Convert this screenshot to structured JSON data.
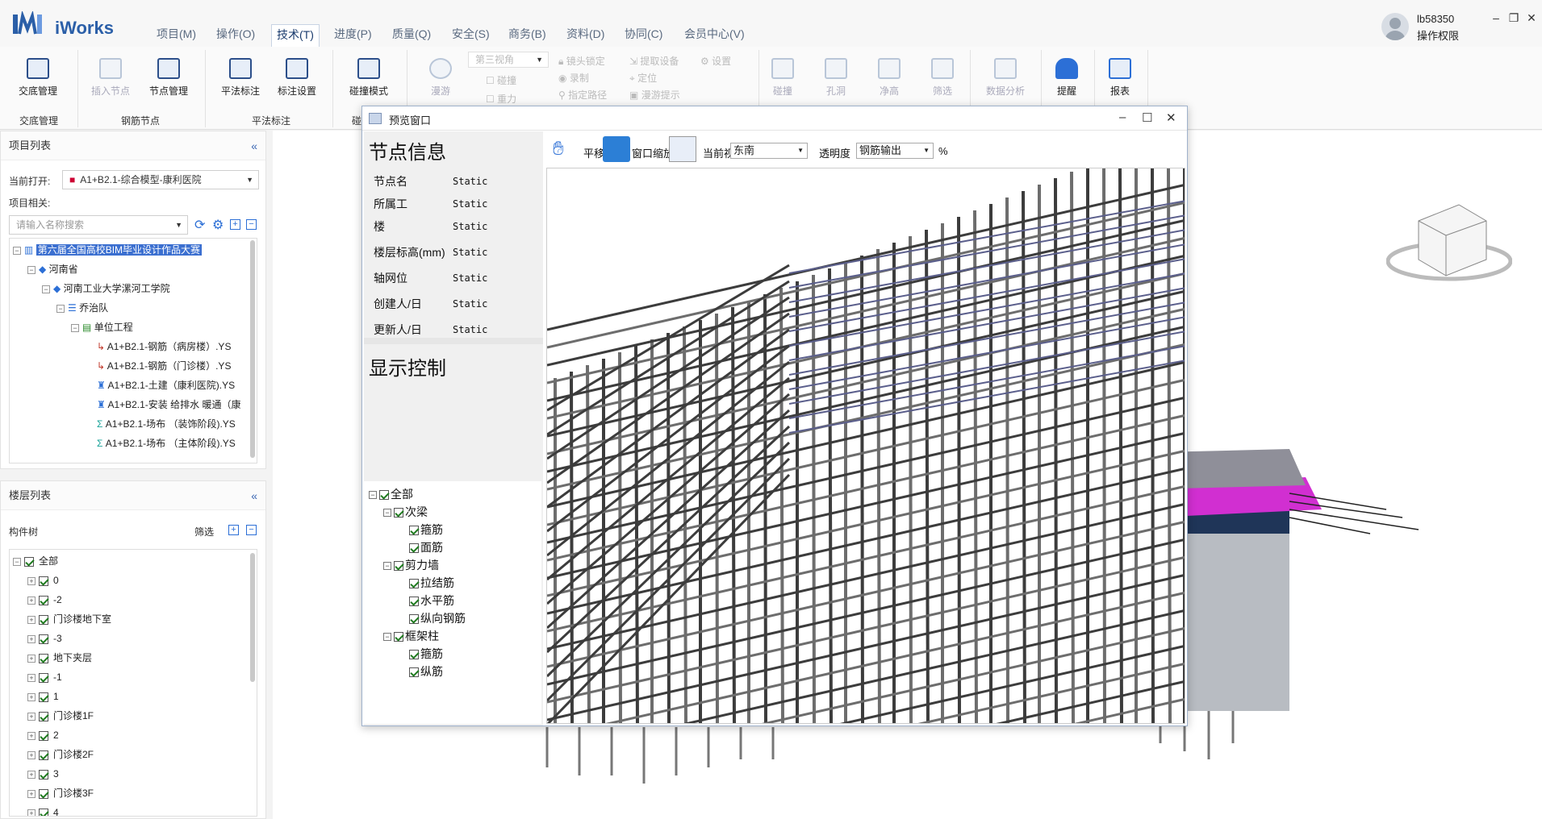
{
  "app": {
    "name": "iWorks"
  },
  "menu": [
    "项目(M)",
    "操作(O)",
    "技术(T)",
    "进度(P)",
    "质量(Q)",
    "安全(S)",
    "商务(B)",
    "资料(D)",
    "协同(C)",
    "会员中心(V)"
  ],
  "menu_active": "技术(T)",
  "user": {
    "name": "lb58350",
    "role": "操作权限"
  },
  "ribbon": {
    "buttons": {
      "jiaodi": "交底管理",
      "insert_node": "插入节点",
      "node_mgmt": "节点管理",
      "pingfa_mark": "平法标注",
      "mark_settings": "标注设置",
      "clash_mode": "碰撞模式",
      "roam": "漫游",
      "clash": "碰撞",
      "hole": "孔洞",
      "net_height": "净高",
      "filter": "筛选",
      "data_analysis": "数据分析",
      "remind": "提醒",
      "report": "报表"
    },
    "options": {
      "view3": "第三视角",
      "lens_lock": "镜头锁定",
      "extract_device": "提取设备",
      "settings": "设置",
      "collide": "碰撞",
      "record": "录制",
      "locate": "定位",
      "gravity": "重力",
      "set_path": "指定路径",
      "roam_hint": "漫游提示"
    },
    "groups": {
      "g1": "交底管理",
      "g2": "钢筋节点",
      "g3": "平法标注",
      "g4": "碰"
    }
  },
  "project_panel": {
    "title": "项目列表",
    "current_open_label": "当前打开:",
    "current_open_value": "A1+B2.1-综合模型-康利医院",
    "related_label": "项目相关:",
    "search_placeholder": "请输入名称搜索",
    "tree": {
      "root": "第六届全国高校BIM毕业设计作品大赛",
      "province": "河南省",
      "school": "河南工业大学漯河工学院",
      "team": "乔治队",
      "unit": "单位工程",
      "files": [
        "A1+B2.1-钢筋（病房楼）.YS",
        "A1+B2.1-钢筋（门诊楼）.YS",
        "A1+B2.1-土建（康利医院).YS",
        "A1+B2.1-安装 给排水 暖通（康",
        "A1+B2.1-场布 （装饰阶段).YS",
        "A1+B2.1-场布 （主体阶段).YS"
      ]
    }
  },
  "floor_panel": {
    "title": "楼层列表",
    "component_tree_label": "构件树",
    "filter_label": "筛选",
    "all_label": "全部",
    "floors": [
      "0",
      "-2",
      "门诊楼地下室",
      "-3",
      "地下夹层",
      "-1",
      "1",
      "门诊楼1F",
      "2",
      "门诊楼2F",
      "3",
      "门诊楼3F",
      "4"
    ]
  },
  "preview": {
    "window_title": "预览窗口",
    "node_info_title": "节点信息",
    "info": [
      {
        "label": "节点名",
        "value": "Static"
      },
      {
        "label": "所属工",
        "value": "Static"
      },
      {
        "label": "楼",
        "value": "Static"
      },
      {
        "label": "楼层标高(mm)",
        "value": "Static"
      },
      {
        "label": "轴网位",
        "value": "Static"
      },
      {
        "label": "创建人/日",
        "value": "Static"
      },
      {
        "label": "更新人/日",
        "value": "Static"
      }
    ],
    "display_control_title": "显示控制",
    "ctrl_tree": {
      "all": "全部",
      "ciliang": "次梁",
      "ciliang_gujin": "箍筋",
      "ciliang_mianjin": "面筋",
      "jianliqiang": "剪力墙",
      "lajiejin": "拉结筋",
      "shuipingjin": "水平筋",
      "zongxiang": "纵向钢筋",
      "kuangjiazhu": "框架柱",
      "kjz_gujin": "箍筋",
      "kjz_zongjin": "纵筋"
    },
    "toolbar": {
      "pan": "平移",
      "window_zoom": "窗口缩放",
      "current_view_label": "当前视口",
      "current_view_value": "东南",
      "transparency_label": "透明度",
      "transparency_value": "钢筋输出",
      "percent": "%"
    }
  },
  "colors": {
    "accent": "#2b5fa8",
    "selection": "#3b6fd0",
    "magenta": "#d12fd1",
    "rebar": "#4a4a4a"
  }
}
